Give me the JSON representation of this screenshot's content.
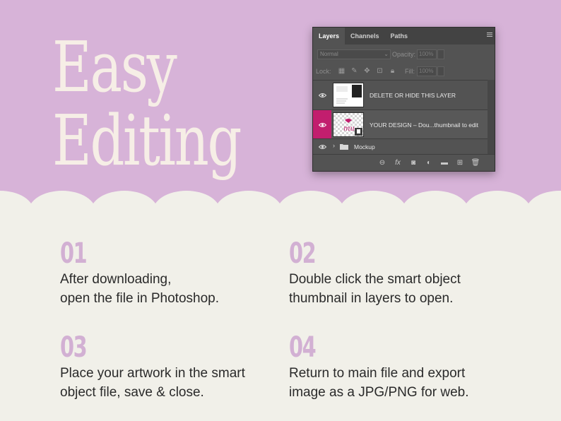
{
  "colors": {
    "top_bg": "#d7b3d8",
    "bottom_bg": "#f1f0e9",
    "headline": "#f6eee6",
    "step_number": "#d2b0d3",
    "panel_bg": "#535353",
    "selected_eye": "#c21e6e"
  },
  "headline": {
    "line1": "Easy",
    "line2": "Editing"
  },
  "panel": {
    "tabs": [
      "Layers",
      "Channels",
      "Paths"
    ],
    "blend_mode": "Normal",
    "opacity_label": "Opacity:",
    "opacity_value": "100%",
    "lock_label": "Lock:",
    "fill_label": "Fill:",
    "fill_value": "100%",
    "layers": [
      {
        "name": "DELETE OR HIDE THIS LAYER",
        "visible": true,
        "selected": false
      },
      {
        "name": "YOUR DESIGN – Dou...thumbnail to edit",
        "visible": true,
        "selected": true
      }
    ],
    "group": {
      "name": "Mockup"
    },
    "thumb_text": {
      "layer1": "Hey\nYou",
      "layer2": "mu"
    },
    "icons": {
      "menu": "panel-menu-icon",
      "eye": "eye-icon",
      "folder": "folder-icon",
      "bottom": [
        "link-icon",
        "fx-icon",
        "mask-icon",
        "adjustment-icon",
        "new-group-icon",
        "new-layer-icon",
        "trash-icon"
      ],
      "locks": [
        "lock-transparent-icon",
        "lock-image-icon",
        "lock-position-icon",
        "lock-artboard-icon",
        "lock-all-icon"
      ]
    }
  },
  "steps": [
    {
      "num": "01",
      "text1": "After downloading,",
      "text2": "open the file in Photoshop."
    },
    {
      "num": "02",
      "text1": "Double click the smart object",
      "text2": "thumbnail in layers to open."
    },
    {
      "num": "03",
      "text1": "Place your artwork in the smart",
      "text2": "object file, save & close."
    },
    {
      "num": "04",
      "text1": "Return to main file and export",
      "text2": "image as a JPG/PNG for web."
    }
  ]
}
